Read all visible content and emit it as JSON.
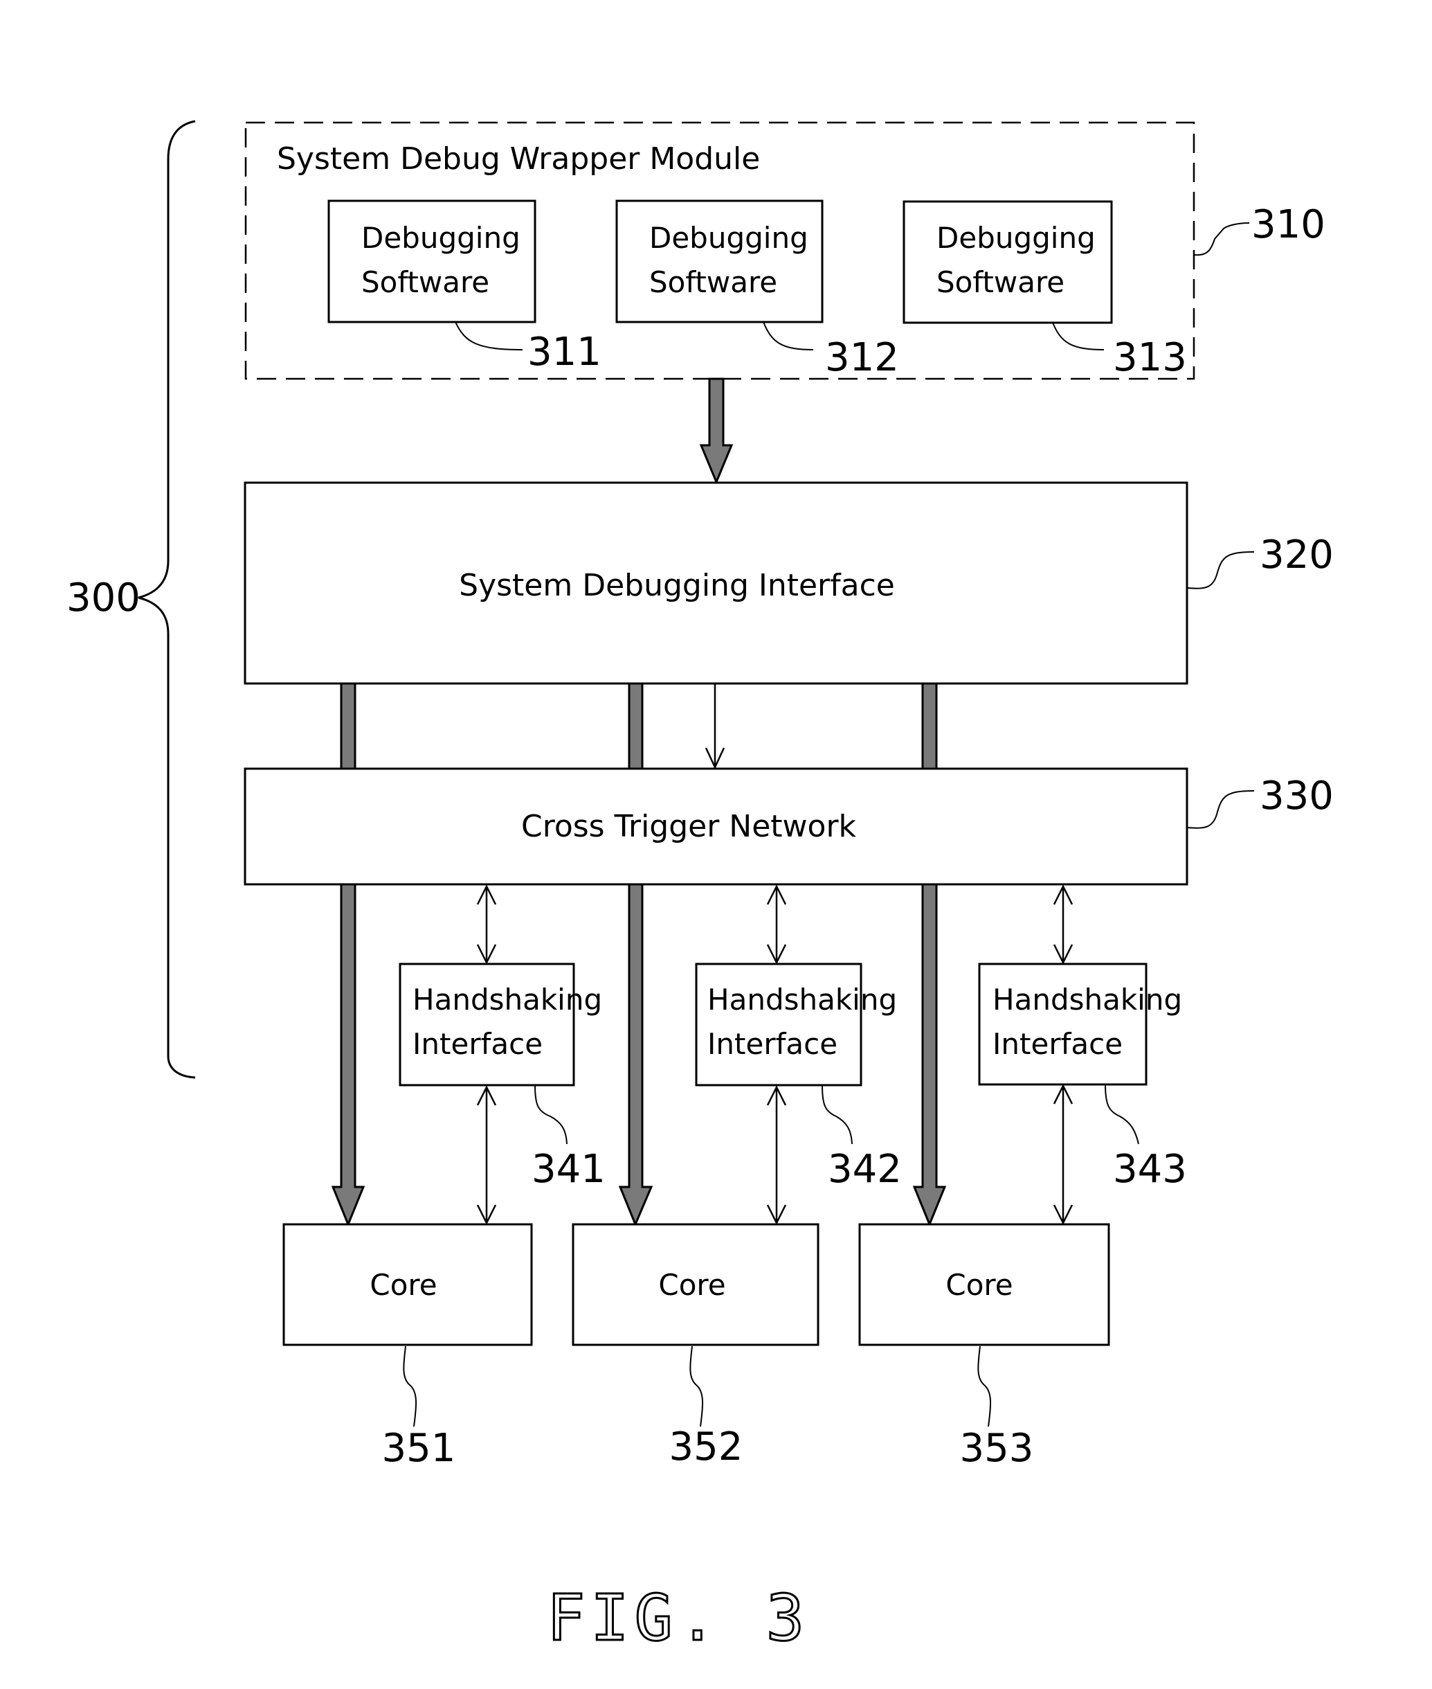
{
  "figure": {
    "caption": "FIG. 3",
    "system_ref": "300"
  },
  "wrapper": {
    "title": "System Debug Wrapper Module",
    "ref": "310",
    "software": [
      {
        "line1": "Debugging",
        "line2": "Software",
        "ref": "311"
      },
      {
        "line1": "Debugging",
        "line2": "Software",
        "ref": "312"
      },
      {
        "line1": "Debugging",
        "line2": "Software",
        "ref": "313"
      }
    ]
  },
  "debug_interface": {
    "label": "System Debugging Interface",
    "ref": "320"
  },
  "cross_trigger": {
    "label": "Cross Trigger Network",
    "ref": "330"
  },
  "handshaking": [
    {
      "line1": "Handshaking",
      "line2": "Interface",
      "ref": "341"
    },
    {
      "line1": "Handshaking",
      "line2": "Interface",
      "ref": "342"
    },
    {
      "line1": "Handshaking",
      "line2": "Interface",
      "ref": "343"
    }
  ],
  "cores": [
    {
      "label": "Core",
      "ref": "351"
    },
    {
      "label": "Core",
      "ref": "352"
    },
    {
      "label": "Core",
      "ref": "353"
    }
  ]
}
